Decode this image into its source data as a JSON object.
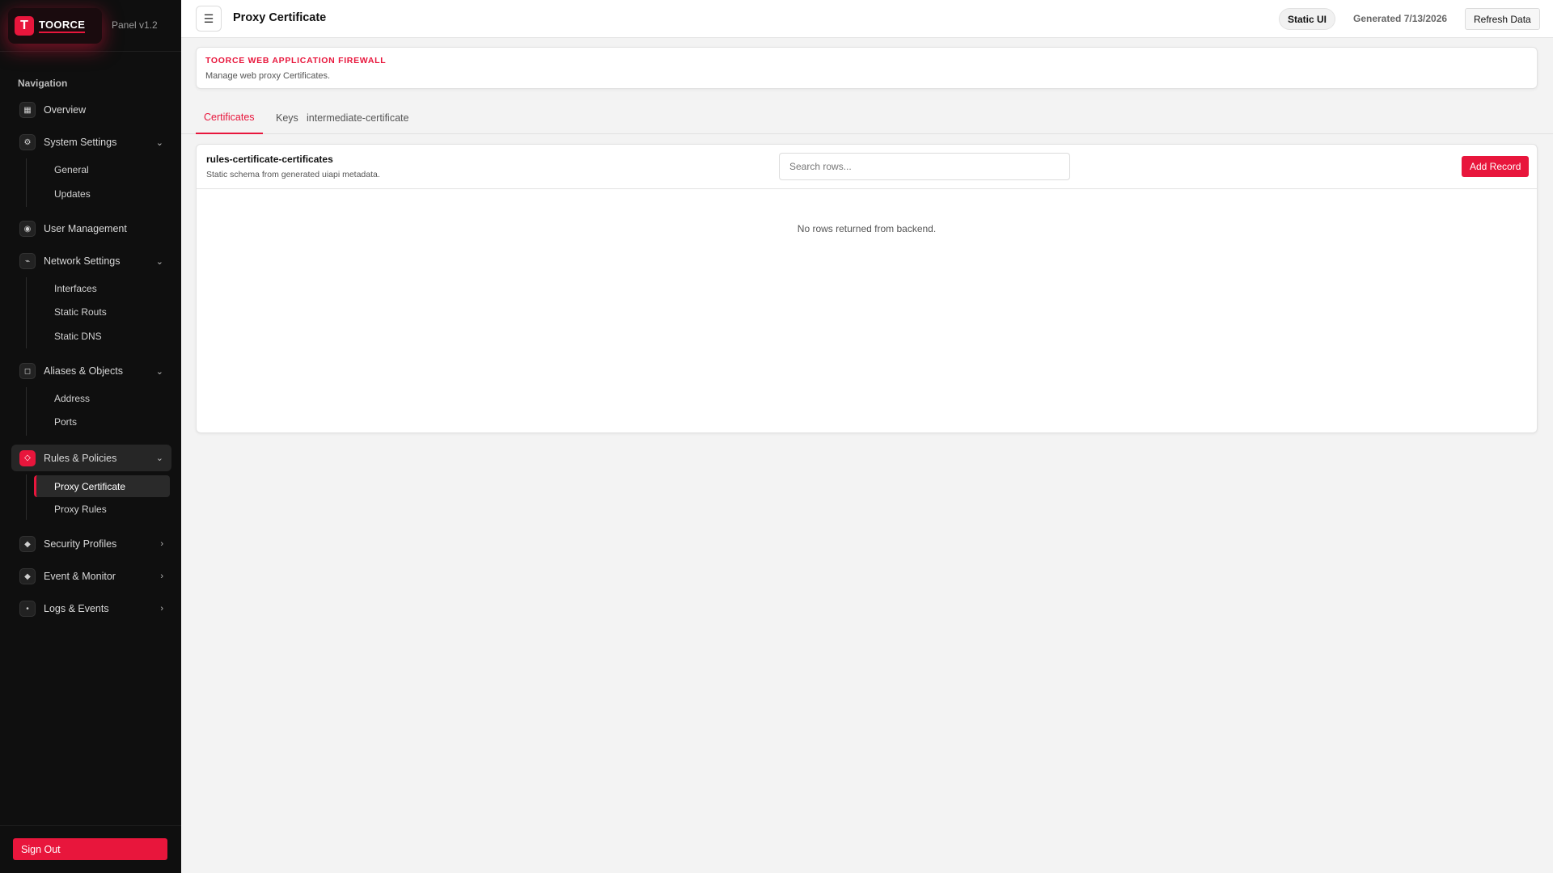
{
  "brand": {
    "logo_letter": "T",
    "name": "TOORCE",
    "version": "Panel v1.2"
  },
  "nav": {
    "title": "Navigation",
    "items": [
      {
        "label": "Overview",
        "icon": "grid-icon",
        "glyph": "▦"
      },
      {
        "label": "System Settings",
        "icon": "gear-icon",
        "glyph": "⚙",
        "expanded": true,
        "children": [
          "General",
          "Updates"
        ]
      },
      {
        "label": "User Management",
        "icon": "user-icon",
        "glyph": "◉"
      },
      {
        "label": "Network Settings",
        "icon": "network-icon",
        "glyph": "⌁",
        "expanded": true,
        "children": [
          "Interfaces",
          "Static Routs",
          "Static DNS"
        ]
      },
      {
        "label": "Aliases & Objects",
        "icon": "box-icon",
        "glyph": "◻",
        "expanded": true,
        "children": [
          "Address",
          "Ports"
        ]
      },
      {
        "label": "Rules & Policies",
        "icon": "diamond-icon",
        "glyph": "◇",
        "expanded": true,
        "active": true,
        "children": [
          "Proxy Certificate",
          "Proxy Rules"
        ],
        "active_child": "Proxy Certificate"
      },
      {
        "label": "Security Profiles",
        "icon": "shield-icon",
        "glyph": "◆"
      },
      {
        "label": "Event & Monitor",
        "icon": "monitor-icon",
        "glyph": "◆"
      },
      {
        "label": "Logs & Events",
        "icon": "log-icon",
        "glyph": "•"
      }
    ],
    "sign_out": "Sign Out"
  },
  "topbar": {
    "menu_glyph": "☰",
    "title": "Proxy Certificate",
    "static_badge": "Static UI",
    "generated": "Generated 7/13/2026",
    "refresh": "Refresh Data"
  },
  "header": {
    "brand_line": "TOORCE WEB APPLICATION FIREWALL",
    "description": "Manage web proxy Certificates."
  },
  "tabs": [
    {
      "label": "Certificates",
      "active": true
    },
    {
      "label": "Keys",
      "active": false
    },
    {
      "label": "intermediate-certificate",
      "active": false
    }
  ],
  "table": {
    "title": "rules-certificate-certificates",
    "subtitle": "Static schema from generated uiapi metadata.",
    "search_placeholder": "Search rows...",
    "add_label": "Add Record",
    "empty_message": "No rows returned from backend."
  },
  "colors": {
    "accent": "#e8163c",
    "sidebar_bg": "#0f0f0f",
    "page_bg": "#f3f3f3"
  }
}
